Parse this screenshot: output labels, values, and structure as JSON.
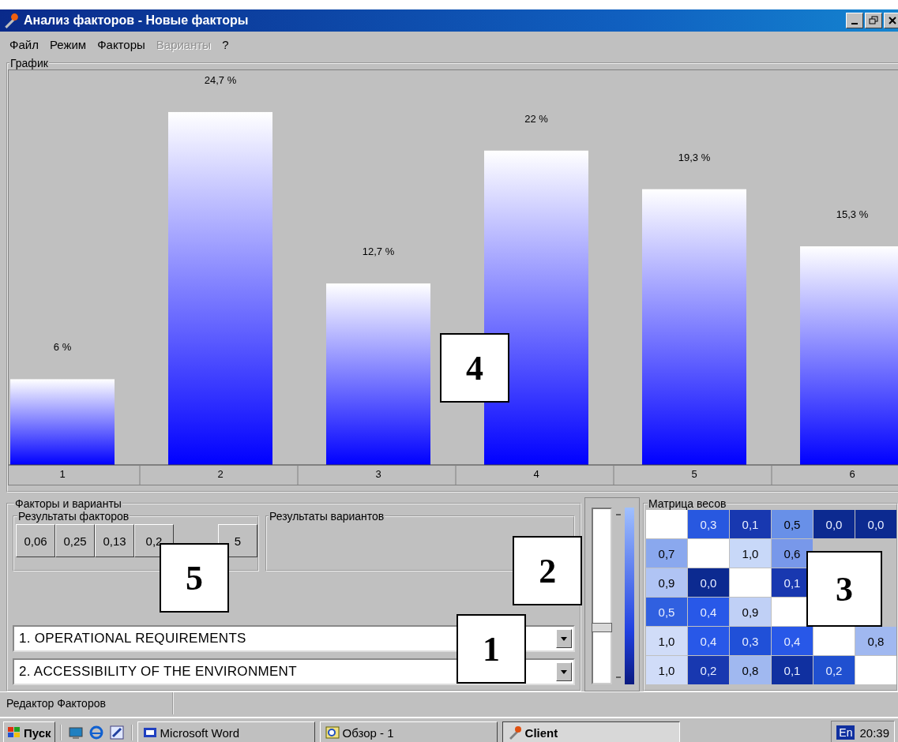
{
  "window": {
    "title": "Анализ факторов - Новые факторы"
  },
  "menu": [
    {
      "label": "Файл",
      "disabled": false
    },
    {
      "label": "Режим",
      "disabled": false
    },
    {
      "label": "Факторы",
      "disabled": false
    },
    {
      "label": "Варианты",
      "disabled": true
    },
    {
      "label": "?",
      "disabled": false
    }
  ],
  "graph": {
    "title": "График",
    "callout": "4",
    "chart_data": {
      "type": "bar",
      "categories": [
        "1",
        "2",
        "3",
        "4",
        "5",
        "6"
      ],
      "values": [
        6,
        24.7,
        12.7,
        22,
        19.3,
        15.3
      ],
      "value_labels": [
        "6 %",
        "24,7 %",
        "12,7 %",
        "22 %",
        "19,3 %",
        "15,3 %"
      ]
    }
  },
  "factors_panel": {
    "title": "Факторы и варианты",
    "callout": "5",
    "factor_results": {
      "title": "Результаты факторов",
      "cells": [
        {
          "value": "0,06"
        },
        {
          "value": "0,25"
        },
        {
          "value": "0,13"
        },
        {
          "value": "0,2"
        },
        {
          "kind": "covered"
        },
        {
          "value": "5"
        }
      ]
    },
    "variant_results": {
      "title": "Результаты вариантов"
    },
    "selectors_callout": "1",
    "selectors": [
      {
        "value": "1. OPERATIONAL REQUIREMENTS"
      },
      {
        "value": "2. ACCESSIBILITY OF THE ENVIRONMENT"
      }
    ]
  },
  "slider": {
    "level": 0.32,
    "callout": "2"
  },
  "matrix": {
    "title": "Матрица весов",
    "callout": "3",
    "rows": [
      {
        "cells": [
          {
            "color": "#ffffff"
          },
          {
            "value": "0,3",
            "color": "#2858e0"
          },
          {
            "value": "0,1",
            "color": "#1838b0"
          },
          {
            "value": "0,5",
            "color": "#6890e8"
          },
          {
            "value": "0,0",
            "color": "#0c2a90"
          },
          {
            "value": "0,0",
            "color": "#0c2a90"
          }
        ]
      },
      {
        "cells": [
          {
            "value": "0,7",
            "color": "#8aa8ee"
          },
          {
            "color": "#ffffff"
          },
          {
            "value": "1,0",
            "color": "#c8d8f8"
          },
          {
            "value": "0,6",
            "color": "#7898ea"
          },
          {
            "kind": "covered"
          },
          {
            "kind": "covered"
          }
        ]
      },
      {
        "cells": [
          {
            "value": "0,9",
            "color": "#b0c4f4"
          },
          {
            "value": "0,0",
            "color": "#0c2a90"
          },
          {
            "color": "#ffffff"
          },
          {
            "value": "0,1",
            "color": "#1838b0"
          },
          {
            "kind": "covered"
          },
          {
            "kind": "covered"
          }
        ]
      },
      {
        "cells": [
          {
            "value": "0,5",
            "color": "#3060e0"
          },
          {
            "value": "0,4",
            "color": "#2858e8"
          },
          {
            "value": "0,9",
            "color": "#c0d0f6"
          },
          {
            "color": "#ffffff"
          },
          {
            "kind": "covered"
          },
          {
            "kind": "covered"
          }
        ]
      },
      {
        "cells": [
          {
            "value": "1,0",
            "color": "#d0dcf8"
          },
          {
            "value": "0,4",
            "color": "#2858e8"
          },
          {
            "value": "0,3",
            "color": "#2050d8"
          },
          {
            "value": "0,4",
            "color": "#2858e8"
          },
          {
            "color": "#ffffff"
          },
          {
            "value": "0,8",
            "color": "#a0b8f0"
          }
        ]
      },
      {
        "cells": [
          {
            "value": "1,0",
            "color": "#d0dcf8"
          },
          {
            "value": "0,2",
            "color": "#1838b0"
          },
          {
            "value": "0,8",
            "color": "#a0b8f0"
          },
          {
            "value": "0,1",
            "color": "#1030a0"
          },
          {
            "value": "0,2",
            "color": "#2050d0"
          },
          {
            "color": "#ffffff"
          }
        ]
      }
    ]
  },
  "status_bar": {
    "text": "Редактор Факторов"
  },
  "taskbar": {
    "start": "Пуск",
    "tasks": [
      {
        "label": "Microsoft Word",
        "selected": false,
        "kind": "word"
      },
      {
        "label": "Обзор - 1",
        "selected": false,
        "kind": "viewer"
      },
      {
        "label": "Client",
        "selected": true,
        "kind": "client"
      }
    ],
    "language": "En",
    "clock": "20:39"
  }
}
